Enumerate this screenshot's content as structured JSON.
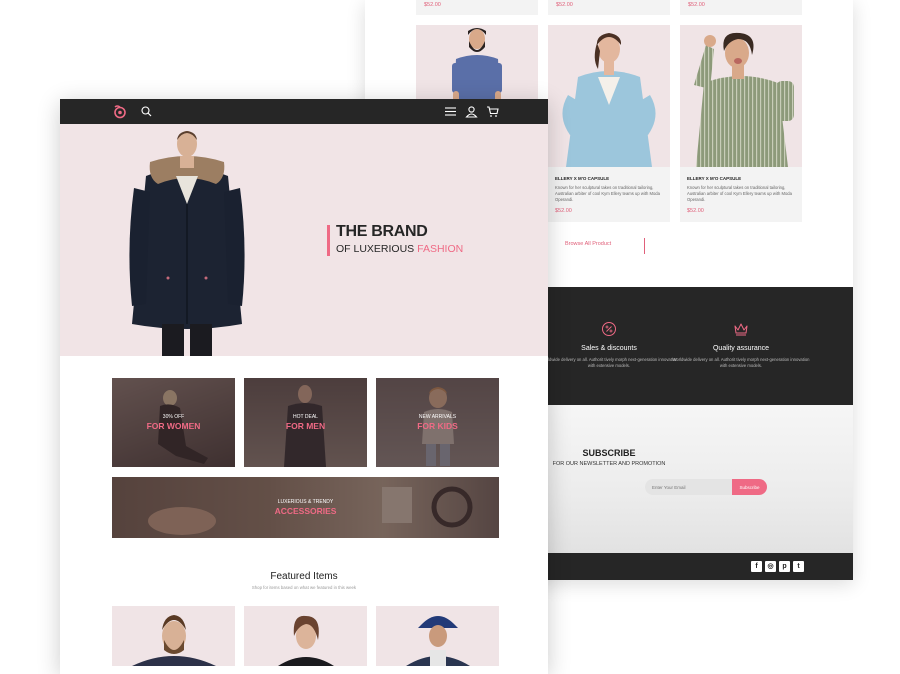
{
  "back_page": {
    "top_prices": [
      "$52.00",
      "$52.00",
      "$52.00"
    ],
    "products": [
      {
        "title": "",
        "description": "",
        "price": ""
      },
      {
        "title": "ELLERY X M'O CAPSULE",
        "description": "Known for her sculptural takes on traditional tailoring, Australian arbiter of cool Kym Ellery teams up with Moda Operandi.",
        "price": "$52.00"
      },
      {
        "title": "ELLERY X M'O CAPSULE",
        "description": "Known for her sculptural takes on traditional tailoring, Australian arbiter of cool Kym Ellery teams up with Moda Operandi.",
        "price": "$52.00"
      }
    ],
    "browse_label": "Browse All Product",
    "features": [
      {
        "icon": "discount-icon",
        "title": "Sales & discounts",
        "description": "Worldwide delivery on all. Authorit tively morph next-generation innovation with extensive models."
      },
      {
        "icon": "crown-icon",
        "title": "Quality assurance",
        "description": "Worldwide delivery on all. Authorit tively morph next-generation innovation with extensive models."
      }
    ],
    "subscribe": {
      "title": "SUBSCRIBE",
      "subtitle": "FOR OUR NEWSLETTER AND PROMOTION",
      "placeholder": "Enter Your Email",
      "button": "Subscribe"
    },
    "social": [
      {
        "icon": "facebook-icon",
        "glyph": "f"
      },
      {
        "icon": "instagram-icon",
        "glyph": "◎"
      },
      {
        "icon": "pinterest-icon",
        "glyph": "p"
      },
      {
        "icon": "twitter-icon",
        "glyph": "t"
      }
    ]
  },
  "front_page": {
    "nav": {
      "logo": "logo-icon",
      "icons": [
        "search-icon",
        "menu-icon",
        "user-icon",
        "cart-icon"
      ]
    },
    "hero": {
      "title": "THE BRAND",
      "subtitle_prefix": "OF LUXERIOUS",
      "subtitle_accent": "FASHION"
    },
    "categories": [
      {
        "line1": "30% OFF",
        "line2": "FOR WOMEN"
      },
      {
        "line1": "HOT DEAL",
        "line2": "FOR MEN"
      },
      {
        "line1": "NEW ARRIVALS",
        "line2": "FOR KIDS"
      },
      {
        "line1": "LUXERIOUS & TRENDY",
        "line2": "ACCESSORIES"
      }
    ],
    "featured": {
      "title": "Featured Items",
      "subtitle": "Shop for items based on what we featured in this week"
    }
  },
  "colors": {
    "accent": "#ef6a85",
    "dark": "#262626",
    "hero_bg": "#f1e4e6"
  }
}
